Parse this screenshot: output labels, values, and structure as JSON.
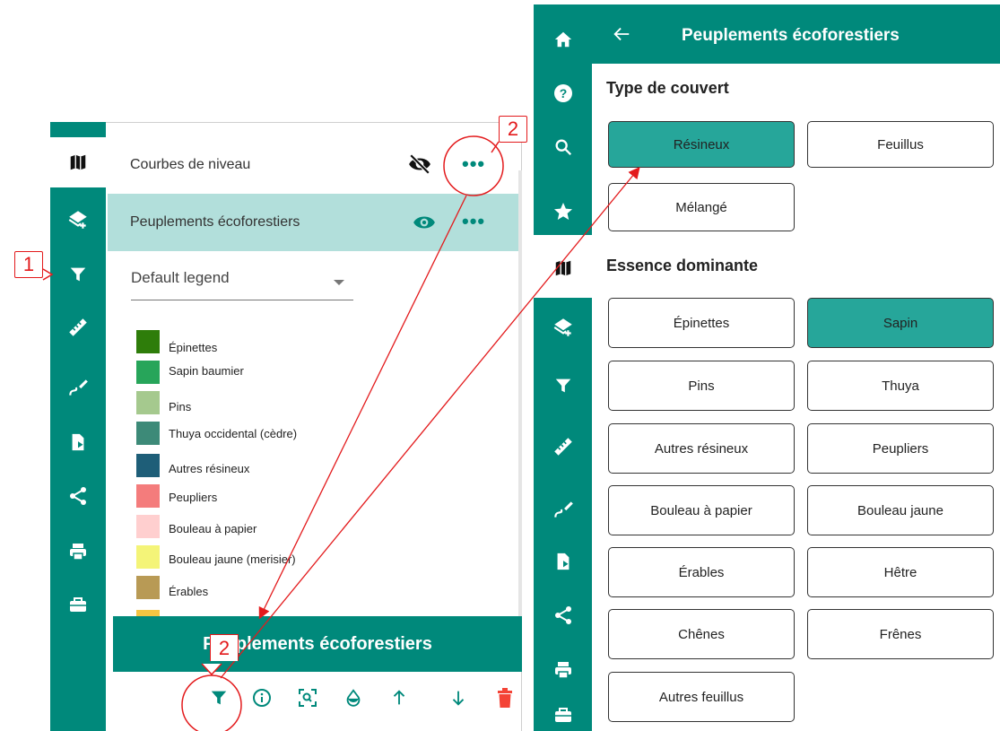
{
  "left_panel": {
    "layers": [
      {
        "name": "Courbes de niveau",
        "visibility": "eye-off-icon",
        "menu": "•••"
      },
      {
        "name": "Peuplements écoforestiers",
        "visibility": "eye-icon",
        "menu": "•••"
      }
    ],
    "legend_select": "Default legend",
    "legend": [
      {
        "label": "Épinettes",
        "color": "#2e7d0a"
      },
      {
        "label": "Sapin baumier",
        "color": "#27a55a"
      },
      {
        "label": "Pins",
        "color": "#a5c98e"
      },
      {
        "label": "Thuya occidental (cèdre)",
        "color": "#3d8a78"
      },
      {
        "label": "Autres résineux",
        "color": "#1e5e78"
      },
      {
        "label": "Peupliers",
        "color": "#f47c7c"
      },
      {
        "label": "Bouleau à papier",
        "color": "#ffcfcf"
      },
      {
        "label": "Bouleau jaune (merisier)",
        "color": "#f4f478"
      },
      {
        "label": "Érables",
        "color": "#b89a55"
      }
    ],
    "layer_title": "Peuplements écoforestiers"
  },
  "right_panel": {
    "title": "Peuplements écoforestiers",
    "back": "←",
    "section1": "Type de couvert",
    "cover": [
      {
        "label": "Résineux",
        "active": true
      },
      {
        "label": "Feuillus",
        "active": false
      },
      {
        "label": "Mélangé",
        "active": false
      }
    ],
    "section2": "Essence dominante",
    "species": [
      {
        "label": "Épinettes",
        "active": false
      },
      {
        "label": "Sapin",
        "active": true
      },
      {
        "label": "Pins",
        "active": false
      },
      {
        "label": "Thuya",
        "active": false
      },
      {
        "label": "Autres résineux",
        "active": false
      },
      {
        "label": "Peupliers",
        "active": false
      },
      {
        "label": "Bouleau à papier",
        "active": false
      },
      {
        "label": "Bouleau jaune",
        "active": false
      },
      {
        "label": "Érables",
        "active": false
      },
      {
        "label": "Hêtre",
        "active": false
      },
      {
        "label": "Chênes",
        "active": false
      },
      {
        "label": "Frênes",
        "active": false
      },
      {
        "label": "Autres feuillus",
        "active": false
      }
    ]
  },
  "annotations": {
    "step1": "1",
    "step2": "2"
  },
  "colors": {
    "teal": "#00897b",
    "teal_light": "#b2dfdb",
    "active_button": "#26a69a",
    "annotation": "#e31a1c",
    "delete": "#f44336"
  }
}
